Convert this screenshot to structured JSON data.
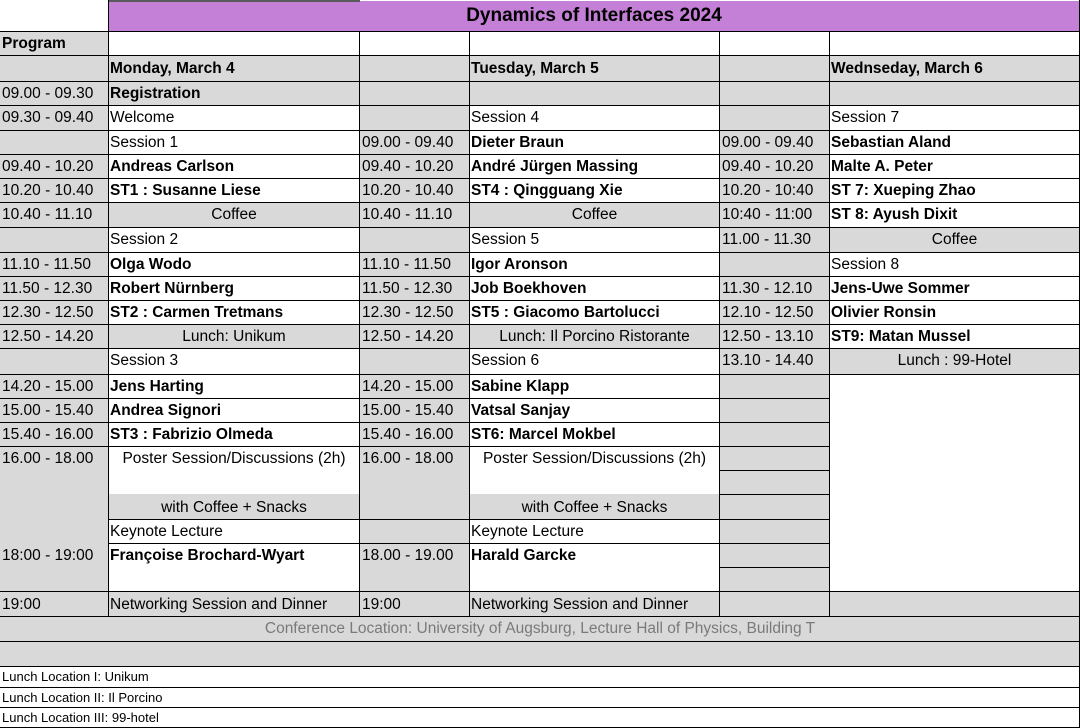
{
  "title": "Dynamics of Interfaces 2024",
  "program_label": "Program",
  "days": [
    "Monday, March 4",
    "Tuesday, March 5",
    "Wednseday, March 6"
  ],
  "monday": {
    "t1": "09.00 - 09.30",
    "registration": "Registration",
    "t2": "09.30 - 09.40",
    "welcome": "Welcome",
    "session1": "Session 1",
    "t3": "09.40 - 10.20",
    "s1a": "Andreas Carlson",
    "t4": "10.20 - 10.40",
    "s1b": "ST1 : Susanne Liese",
    "t5": "10.40 - 11.10",
    "coffee": "Coffee",
    "session2": "Session 2",
    "t6": "11.10 - 11.50",
    "s2a": "Olga Wodo",
    "t7": "11.50 - 12.30",
    "s2b": "Robert Nürnberg",
    "t8": "12.30 - 12.50",
    "s2c": "ST2 : Carmen Tretmans",
    "t9": "12.50 - 14.20",
    "lunch": "Lunch: Unikum",
    "session3": "Session 3",
    "t10": "14.20 - 15.00",
    "s3a": "Jens Harting",
    "t11": "15.00 - 15.40",
    "s3b": "Andrea Signori",
    "t12": "15.40 - 16.00",
    "s3c": "ST3 : Fabrizio Olmeda",
    "t13": "16.00 - 18.00",
    "poster": "Poster Session/Discussions (2h)",
    "poster2": "with Coffee + Snacks",
    "keynote": "Keynote Lecture",
    "t14": "18:00 - 19:00",
    "keynote_speaker": "Françoise Brochard-Wyart",
    "t15": "19:00",
    "dinner": "Networking Session and Dinner"
  },
  "tuesday": {
    "session4": "Session 4",
    "t1": "09.00 - 09.40",
    "s4a": "Dieter Braun",
    "t2": "09.40 - 10.20",
    "s4b": "André Jürgen Massing",
    "t3": "10.20 - 10.40",
    "s4c": "ST4 : Qingguang Xie",
    "t4": "10.40 - 11.10",
    "coffee": "Coffee",
    "session5": "Session 5",
    "t5": "11.10 - 11.50",
    "s5a": "Igor Aronson",
    "t6": "11.50 - 12.30",
    "s5b": "Job Boekhoven",
    "t7": "12.30 - 12.50",
    "s5c": "ST5 : Giacomo Bartolucci",
    "t8": "12.50 - 14.20",
    "lunch": "Lunch: Il Porcino Ristorante",
    "session6": "Session 6",
    "t9": "14.20 - 15.00",
    "s6a": "Sabine Klapp",
    "t10": "15.00 - 15.40",
    "s6b": "Vatsal Sanjay",
    "t11": "15.40 - 16.00",
    "s6c": "ST6: Marcel Mokbel",
    "t12": "16.00 - 18.00",
    "poster": "Poster Session/Discussions (2h)",
    "poster2": "with Coffee + Snacks",
    "keynote": "Keynote Lecture",
    "t13": "18.00 - 19.00",
    "keynote_speaker": "Harald Garcke",
    "t14": "19:00",
    "dinner": "Networking Session and Dinner"
  },
  "wednesday": {
    "session7": "Session 7",
    "t1": "09.00 - 09.40",
    "s7a": "Sebastian Aland",
    "t2": "09.40 - 10.20",
    "s7b": "Malte A. Peter",
    "t3": "10.20 - 10:40",
    "s7c": "ST 7: Xueping Zhao",
    "t4": "10:40 - 11:00",
    "s7d": "ST 8: Ayush Dixit",
    "t5": "11.00 - 11.30",
    "coffee": "Coffee",
    "session8": "Session 8",
    "t6": "11.30 - 12.10",
    "s8a": "Jens-Uwe Sommer",
    "t7": "12.10 - 12.50",
    "s8b": "Olivier Ronsin",
    "t8": "12.50 - 13.10",
    "s8c": "ST9: Matan Mussel",
    "t9": "13.10 - 14.40",
    "lunch": "Lunch : 99-Hotel"
  },
  "conference_location": "Conference Location: University of Augsburg, Lecture Hall of Physics, Building T",
  "lunch_locations": [
    "Lunch Location I: Unikum",
    "Lunch Location II: Il Porcino",
    "Lunch Location III: 99-hotel"
  ]
}
